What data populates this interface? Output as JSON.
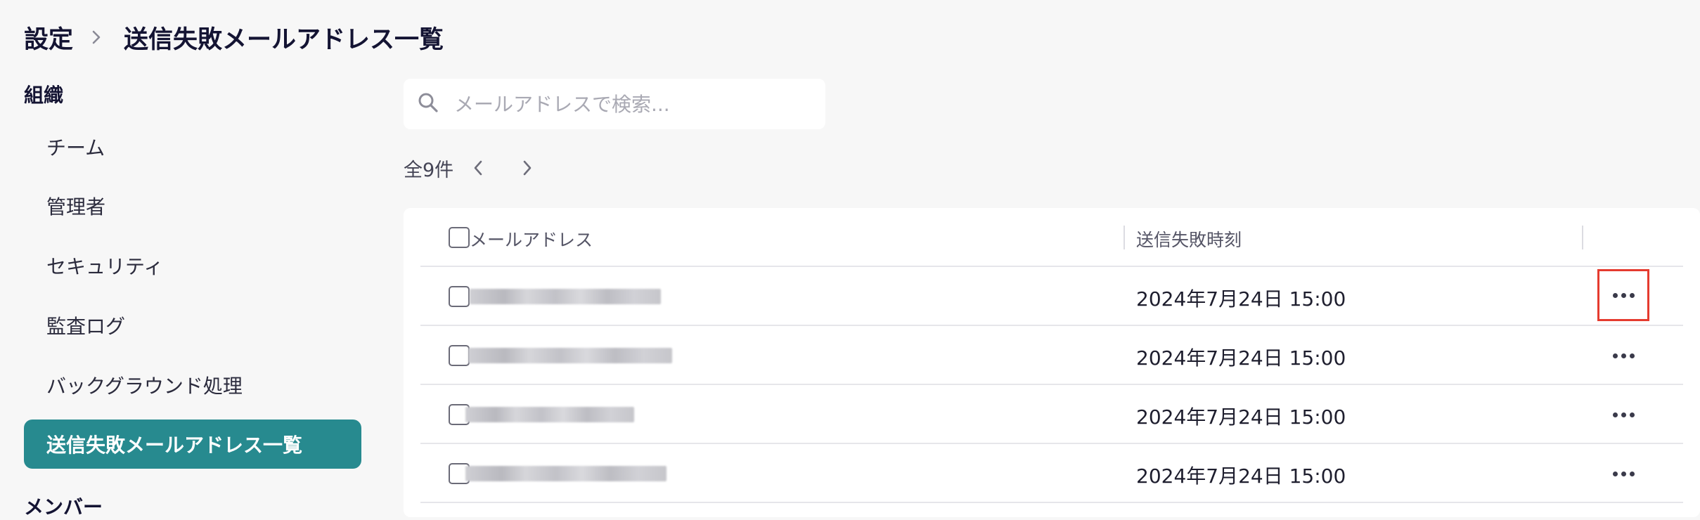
{
  "breadcrumb": {
    "parent": "設定",
    "current": "送信失敗メールアドレス一覧"
  },
  "sidebar": {
    "group_org": "組織",
    "items": [
      {
        "label": "チーム"
      },
      {
        "label": "管理者"
      },
      {
        "label": "セキュリティ"
      },
      {
        "label": "監査ログ"
      },
      {
        "label": "バックグラウンド処理"
      },
      {
        "label": "送信失敗メールアドレス一覧",
        "active": true
      }
    ],
    "group_member": "メンバー"
  },
  "search": {
    "placeholder": "メールアドレスで検索...",
    "value": ""
  },
  "pager": {
    "total_label": "全9件"
  },
  "table": {
    "headers": {
      "email": "メールアドレス",
      "failed_at": "送信失敗時刻"
    },
    "rows": [
      {
        "email": "████████████",
        "failed_at": "2024年7月24日 15:00"
      },
      {
        "email": "█████████████",
        "failed_at": "2024年7月24日 15:00"
      },
      {
        "email": "██████████",
        "failed_at": "2024年7月24日 15:00"
      },
      {
        "email": "████████████",
        "failed_at": "2024年7月24日 15:00"
      }
    ]
  },
  "colors": {
    "accent": "#278a8f",
    "highlight_border": "#e53b2f",
    "background": "#f7f7f7"
  },
  "icons": {
    "breadcrumb_separator": "chevron-right-icon",
    "search": "search-icon",
    "prev": "chevron-left-icon",
    "next": "chevron-right-icon",
    "row_actions": "more-horizontal-icon"
  }
}
